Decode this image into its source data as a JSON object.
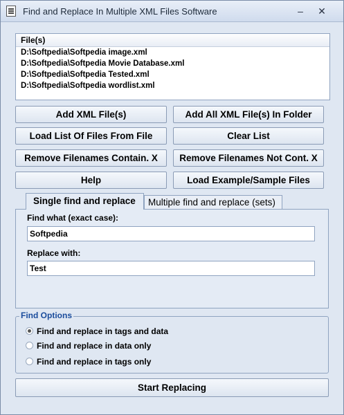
{
  "window": {
    "title": "Find and Replace In Multiple XML Files Software",
    "controls": {
      "minimize": "–",
      "close": "✕"
    }
  },
  "file_list": {
    "header": "File(s)",
    "items": [
      "D:\\Softpedia\\Softpedia image.xml",
      "D:\\Softpedia\\Softpedia Movie Database.xml",
      "D:\\Softpedia\\Softpedia Tested.xml",
      "D:\\Softpedia\\Softpedia wordlist.xml"
    ]
  },
  "buttons": {
    "add_xml_files": "Add XML File(s)",
    "add_all_in_folder": "Add All XML File(s) In Folder",
    "load_list": "Load List Of Files From File",
    "clear_list": "Clear List",
    "remove_contain": "Remove Filenames Contain. X",
    "remove_not_contain": "Remove Filenames Not Cont. X",
    "help": "Help",
    "load_example": "Load Example/Sample Files",
    "start_replacing": "Start Replacing"
  },
  "tabs": {
    "single": "Single find and replace",
    "multiple": "Multiple find and replace (sets)"
  },
  "single_tab": {
    "find_label": "Find what (exact case):",
    "find_value": "Softpedia",
    "replace_label": "Replace with:",
    "replace_value": "Test"
  },
  "find_options": {
    "title": "Find Options",
    "options": [
      {
        "label": "Find and replace in tags and data",
        "selected": true
      },
      {
        "label": "Find and replace in data only",
        "selected": false
      },
      {
        "label": "Find and replace in tags only",
        "selected": false
      }
    ]
  }
}
